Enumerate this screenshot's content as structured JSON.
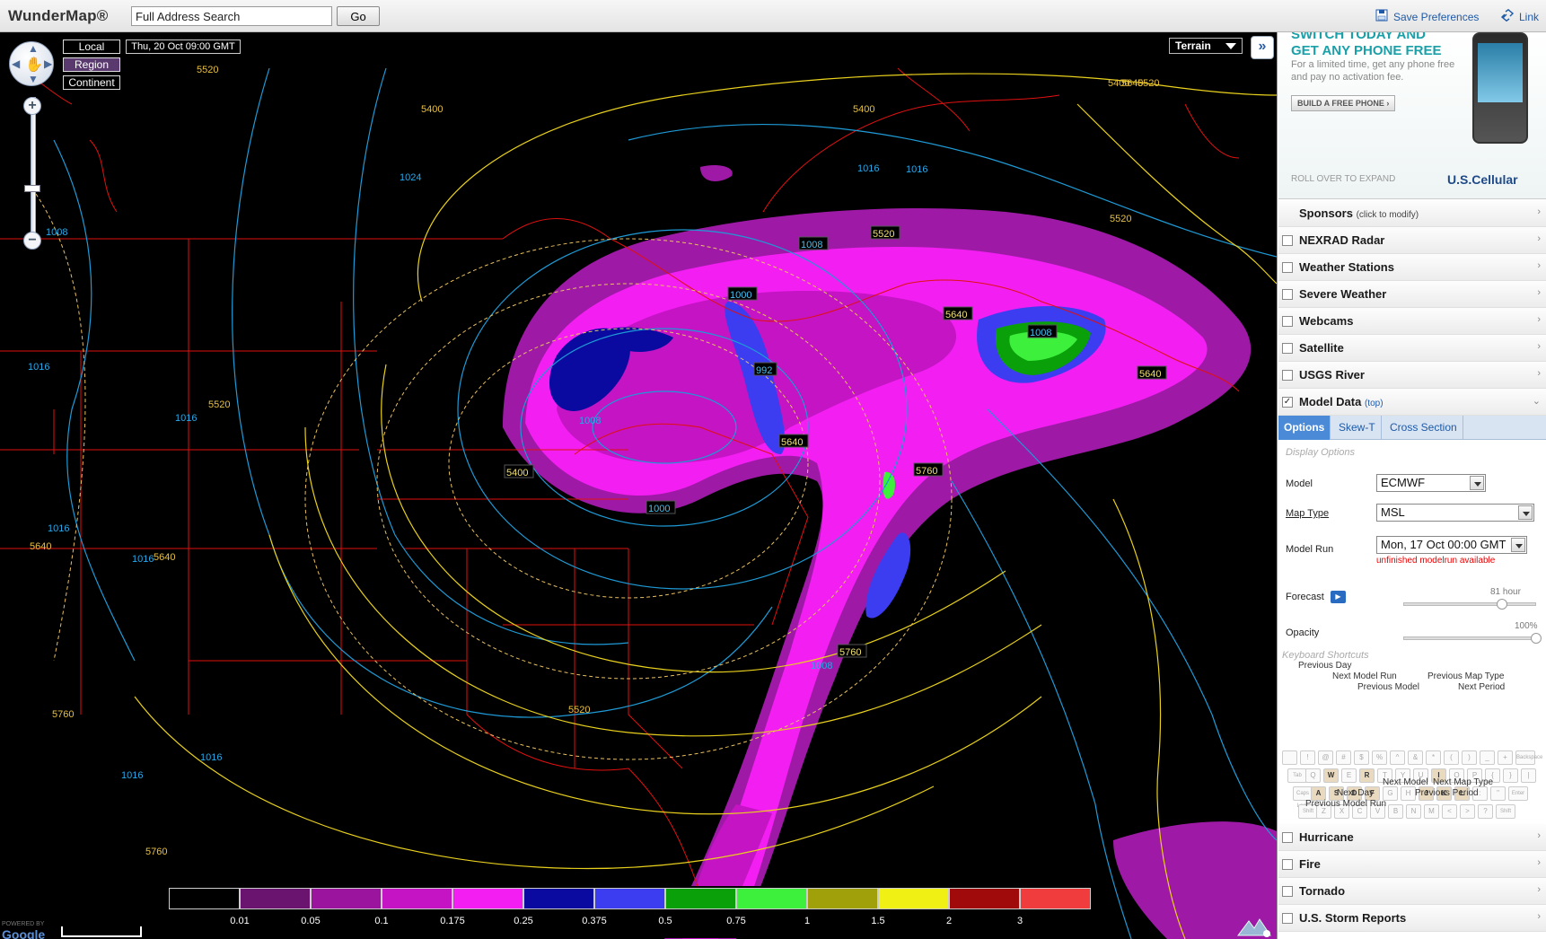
{
  "header": {
    "logo": "WunderMap®",
    "search_value": "Full Address Search",
    "go_label": "Go",
    "save_prefs": "Save Preferences",
    "link": "Link"
  },
  "map": {
    "view_buttons": [
      "Local",
      "Region",
      "Continent"
    ],
    "active_view": "Region",
    "timestamp": "Thu, 20 Oct 09:00 GMT",
    "terrain_select": "Terrain",
    "expand_icon": "double-chevron-right-icon",
    "contour_labels_yellow": [
      "5400",
      "5520",
      "5640",
      "5760"
    ],
    "contour_labels_blue": [
      "1000",
      "1008",
      "1016",
      "1024",
      "992"
    ],
    "labels": [
      {
        "t": "5520",
        "c": "y"
      },
      {
        "t": "5400",
        "c": "y"
      },
      {
        "t": "5400",
        "c": "y"
      },
      {
        "t": "5520",
        "c": "y"
      },
      {
        "t": "5520",
        "c": "y"
      },
      {
        "t": "5520",
        "c": "y"
      },
      {
        "t": "5640",
        "c": "y"
      },
      {
        "t": "5640",
        "c": "y"
      },
      {
        "t": "5760",
        "c": "y"
      },
      {
        "t": "5760",
        "c": "y"
      },
      {
        "t": "5400",
        "c": "y"
      },
      {
        "t": "5520",
        "c": "y"
      },
      {
        "t": "5640",
        "c": "y"
      },
      {
        "t": "1024",
        "c": "b"
      },
      {
        "t": "1016",
        "c": "b"
      },
      {
        "t": "1008",
        "c": "b"
      },
      {
        "t": "1016",
        "c": "b"
      },
      {
        "t": "1016",
        "c": "b"
      },
      {
        "t": "1016",
        "c": "b"
      },
      {
        "t": "1016",
        "c": "b"
      },
      {
        "t": "1016",
        "c": "b"
      },
      {
        "t": "1016",
        "c": "b"
      },
      {
        "t": "1008",
        "c": "b"
      },
      {
        "t": "1016",
        "c": "b"
      },
      {
        "t": "1008",
        "c": "b"
      },
      {
        "t": "5400",
        "c": "yb"
      },
      {
        "t": "5640",
        "c": "yb"
      },
      {
        "t": "5760",
        "c": "yb"
      },
      {
        "t": "5760",
        "c": "yb"
      },
      {
        "t": "5640",
        "c": "yb"
      },
      {
        "t": "5640",
        "c": "yb"
      },
      {
        "t": "5520",
        "c": "yb"
      },
      {
        "t": "1008",
        "c": "bb"
      },
      {
        "t": "1000",
        "c": "bb"
      },
      {
        "t": "992",
        "c": "bb"
      },
      {
        "t": "1000",
        "c": "bb"
      },
      {
        "t": "1008",
        "c": "bb"
      }
    ],
    "powered_by": "POWERED BY",
    "google": "Google"
  },
  "legend": {
    "colors": [
      "#000000",
      "#6a1470",
      "#9a149e",
      "#c414c4",
      "#f21ef2",
      "#0a0aa0",
      "#3c3cf0",
      "#0aa00a",
      "#3cf03c",
      "#a0a00a",
      "#f0f014",
      "#a00a0a",
      "#f03c3c"
    ],
    "labels": [
      "0.01",
      "0.05",
      "0.1",
      "0.175",
      "0.25",
      "0.375",
      "0.5",
      "0.75",
      "1",
      "1.5",
      "2",
      "3"
    ]
  },
  "sidebar": {
    "ad": {
      "headline_1": "SWITCH TODAY AND",
      "headline_2": "GET ANY PHONE FREE",
      "body": "For a limited time, get any phone free and pay no activation fee.",
      "cta": "BUILD A FREE PHONE ›",
      "roll": "ROLL OVER TO EXPAND",
      "brand": "U.S.Cellular"
    },
    "sponsors_label": "Sponsors",
    "sponsors_hint": "(click to modify)",
    "layers_top": [
      {
        "label": "NEXRAD Radar",
        "checked": false
      },
      {
        "label": "Weather Stations",
        "checked": false
      },
      {
        "label": "Severe Weather",
        "checked": false
      },
      {
        "label": "Webcams",
        "checked": false
      },
      {
        "label": "Satellite",
        "checked": false
      },
      {
        "label": "USGS River",
        "checked": false
      }
    ],
    "model_data": {
      "label": "Model Data",
      "top_link": "(top)",
      "checked": true
    },
    "tabs": [
      "Options",
      "Skew-T",
      "Cross Section"
    ],
    "display_options": "Display Options",
    "model_label": "Model",
    "model_value": "ECMWF",
    "maptype_label": "Map Type",
    "maptype_value": "MSL",
    "modelrun_label": "Model Run",
    "modelrun_value": "Mon, 17 Oct 00:00 GMT",
    "modelrun_note": "unfinished modelrun available",
    "forecast_label": "Forecast",
    "forecast_value": "81 hour",
    "forecast_fraction": 0.74,
    "opacity_label": "Opacity",
    "opacity_value": "100%",
    "opacity_fraction": 1.0,
    "keyboard_header": "Keyboard Shortcuts",
    "kbd_labels": [
      "Previous Day",
      "Next Model Run",
      "Previous Model",
      "Previous Map Type",
      "Next Period",
      "Next Model",
      "Next Day",
      "Previous Model Run",
      "Next Map Type",
      "Previous Period"
    ],
    "kbd_row1": [
      "",
      "!",
      "@",
      "#",
      "$",
      "%",
      "^",
      "&",
      "*",
      "(",
      ")",
      "_",
      "+",
      "Backspace"
    ],
    "kbd_row2": [
      "Tab",
      "Q",
      "W",
      "E",
      "R",
      "T",
      "Y",
      "U",
      "I",
      "O",
      "P",
      "{",
      "}",
      "|"
    ],
    "kbd_row3": [
      "Caps Lock",
      "A",
      "S",
      "D",
      "F",
      "G",
      "H",
      "J",
      "K",
      "L",
      ":",
      "\"",
      "Enter"
    ],
    "kbd_row4": [
      "Shift",
      "Z",
      "X",
      "C",
      "V",
      "B",
      "N",
      "M",
      "<",
      ">",
      "?",
      "Shift"
    ],
    "kbd_highlight": [
      "W",
      "R",
      "I",
      "A",
      "S",
      "D",
      "F",
      "J",
      "K",
      "L"
    ],
    "layers_bottom": [
      {
        "label": "Hurricane",
        "checked": false
      },
      {
        "label": "Fire",
        "checked": false
      },
      {
        "label": "Tornado",
        "checked": false
      },
      {
        "label": "U.S. Storm Reports",
        "checked": false
      }
    ]
  }
}
